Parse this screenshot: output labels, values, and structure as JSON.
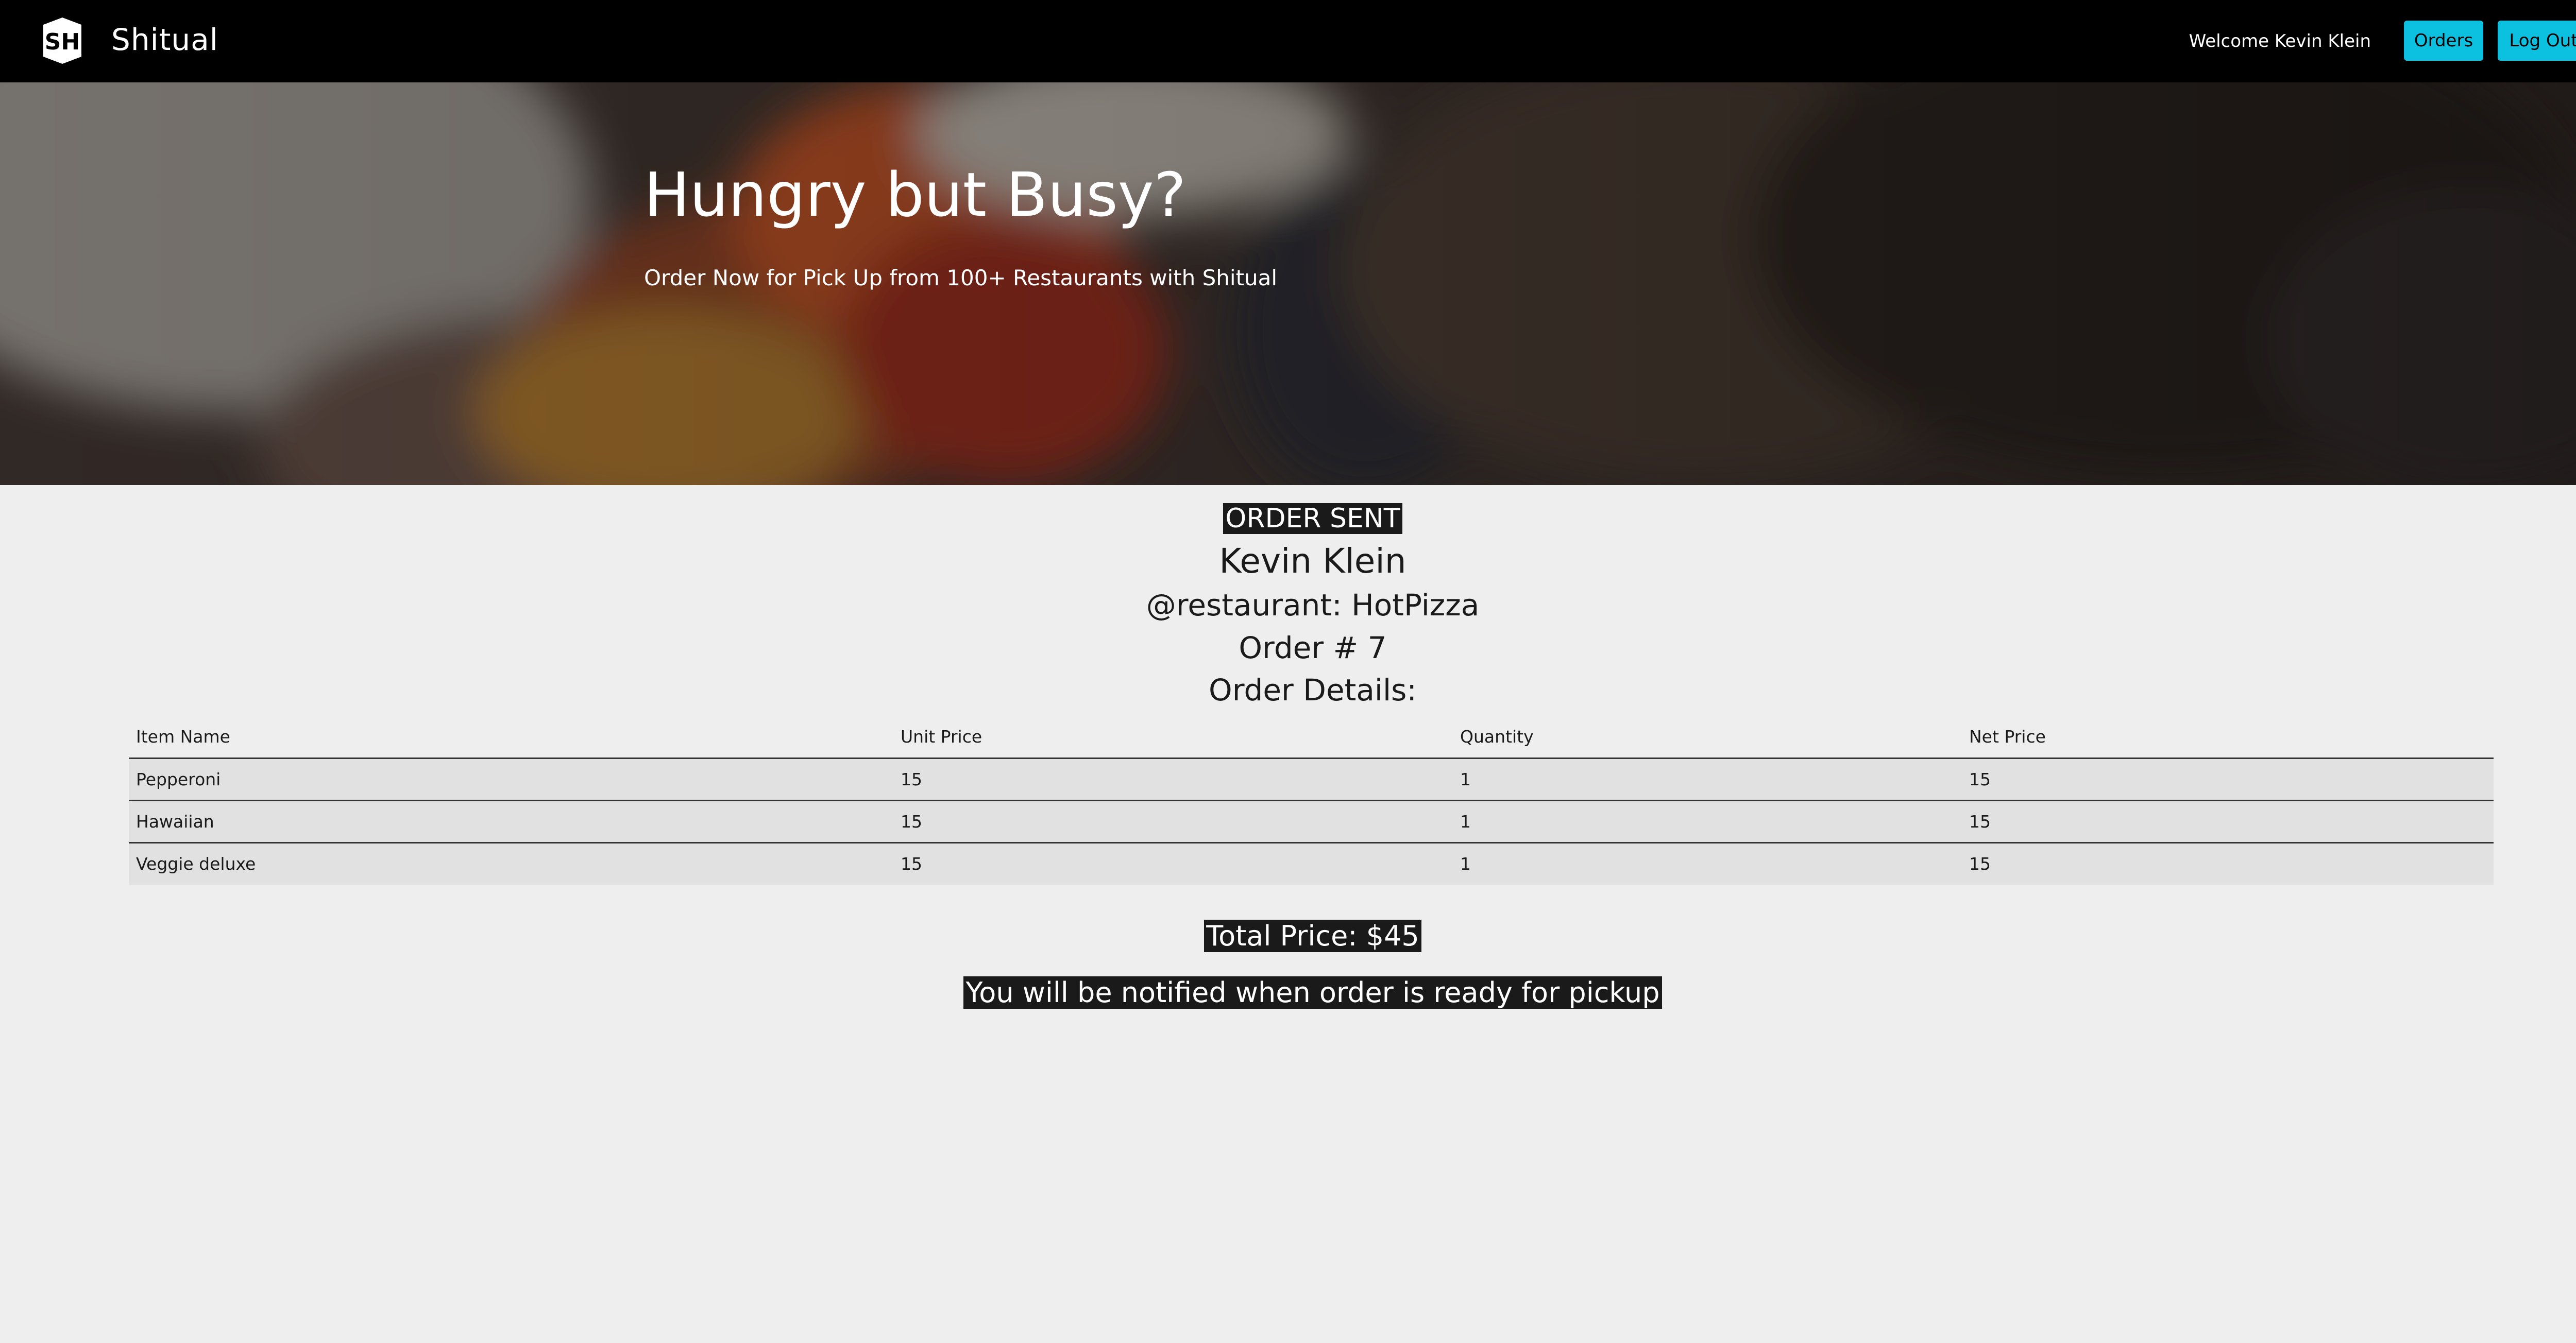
{
  "navbar": {
    "logo_text": "SH",
    "brand": "Shitual",
    "welcome": "Welcome Kevin Klein",
    "orders_label": "Orders",
    "logout_label": "Log Out",
    "button_color": "#0cc0df"
  },
  "hero": {
    "title": "Hungry but Busy?",
    "subtitle": "Order Now for Pick Up from 100+ Restaurants with Shitual"
  },
  "order": {
    "status": "ORDER SENT",
    "customer": "Kevin Klein",
    "restaurant": "@restaurant: HotPizza",
    "number": "Order # 7",
    "details_heading": "Order Details:",
    "table": {
      "headers": [
        "Item Name",
        "Unit Price",
        "Quantity",
        "Net Price"
      ],
      "rows": [
        [
          "Pepperoni",
          "15",
          "1",
          "15"
        ],
        [
          "Hawaiian",
          "15",
          "1",
          "15"
        ],
        [
          "Veggie deluxe",
          "15",
          "1",
          "15"
        ]
      ]
    },
    "total": "Total Price: $45",
    "notice": "You will be notified when order is ready for pickup"
  }
}
